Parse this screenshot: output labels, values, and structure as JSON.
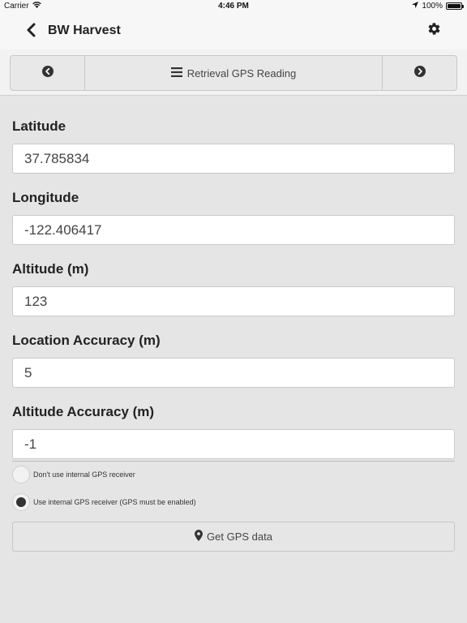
{
  "status_bar": {
    "carrier": "Carrier",
    "time": "4:46 PM",
    "battery": "100%",
    "battery_level": 1.0
  },
  "header": {
    "title": "BW Harvest",
    "back_icon": "chevron-left-icon",
    "settings_icon": "gear-icon"
  },
  "nav": {
    "title": "Retrieval GPS Reading",
    "prev_icon": "circle-chevron-left-icon",
    "next_icon": "circle-chevron-right-icon",
    "menu_icon": "hamburger-menu-icon"
  },
  "fields": [
    {
      "label": "Latitude",
      "value": "37.785834"
    },
    {
      "label": "Longitude",
      "value": "-122.406417"
    },
    {
      "label": "Altitude (m)",
      "value": "123"
    },
    {
      "label": "Location Accuracy (m)",
      "value": "5"
    },
    {
      "label": "Altitude Accuracy (m)",
      "value": "-1"
    }
  ],
  "gps_options": [
    {
      "label": "Don't use internal GPS receiver",
      "selected": false
    },
    {
      "label": "Use internal GPS receiver (GPS must be enabled)",
      "selected": true
    }
  ],
  "gps_button": {
    "label": "Get GPS data",
    "icon": "map-marker-icon"
  },
  "colors": {
    "background": "#e5e5e5",
    "header": "#f7f7f7",
    "input_bg": "#ffffff",
    "text": "#222222"
  }
}
